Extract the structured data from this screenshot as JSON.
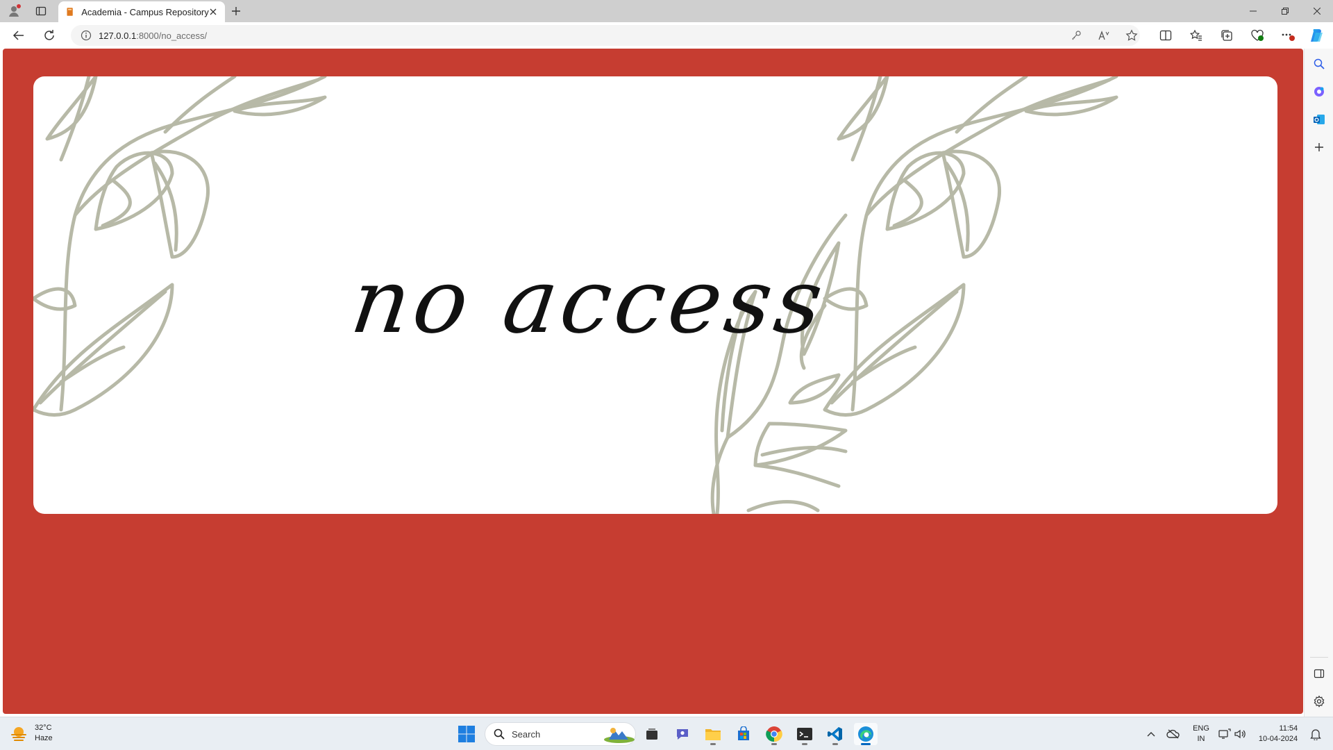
{
  "browser": {
    "tab_title": "Academia - Campus Repository",
    "url_host": "127.0.0.1",
    "url_path": ":8000/no_access/"
  },
  "page": {
    "headline": "no access",
    "background_color": "#c63d31",
    "card_color": "#ffffff",
    "leaf_color": "#b7b9a7"
  },
  "taskbar": {
    "weather_temp": "32°C",
    "weather_desc": "Haze",
    "search_placeholder": "Search",
    "lang_line1": "ENG",
    "lang_line2": "IN",
    "time": "11:54",
    "date": "10-04-2024"
  }
}
